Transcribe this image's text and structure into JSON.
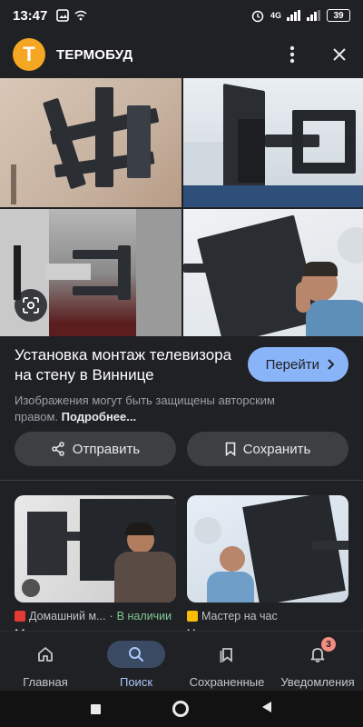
{
  "status_bar": {
    "time": "13:47",
    "network": "4G",
    "battery": "39"
  },
  "header": {
    "logo_letter": "Т",
    "site_name": "ТЕРМОБУД"
  },
  "result": {
    "title": "Установка монтаж телевизора на стену в Виннице",
    "go_label": "Перейти",
    "disclaimer_text": "Изображения могут быть защищены авторским правом.",
    "disclaimer_link": "Подробнее..."
  },
  "actions": {
    "share_label": "Отправить",
    "save_label": "Сохранить"
  },
  "related": [
    {
      "source": "Домашний м...",
      "availability": "В наличии",
      "title": "Монтаж телевизора на",
      "fav_color": "#e53935"
    },
    {
      "source": "Мастер на час",
      "availability": "",
      "title": "У",
      "fav_color": "#fbbc04"
    }
  ],
  "bottom_nav": [
    {
      "label": "Главная",
      "icon": "home-icon"
    },
    {
      "label": "Поиск",
      "icon": "search-icon",
      "active": true
    },
    {
      "label": "Сохраненные",
      "icon": "bookmarks-icon"
    },
    {
      "label": "Уведомления",
      "icon": "bell-icon",
      "badge": "3"
    }
  ]
}
